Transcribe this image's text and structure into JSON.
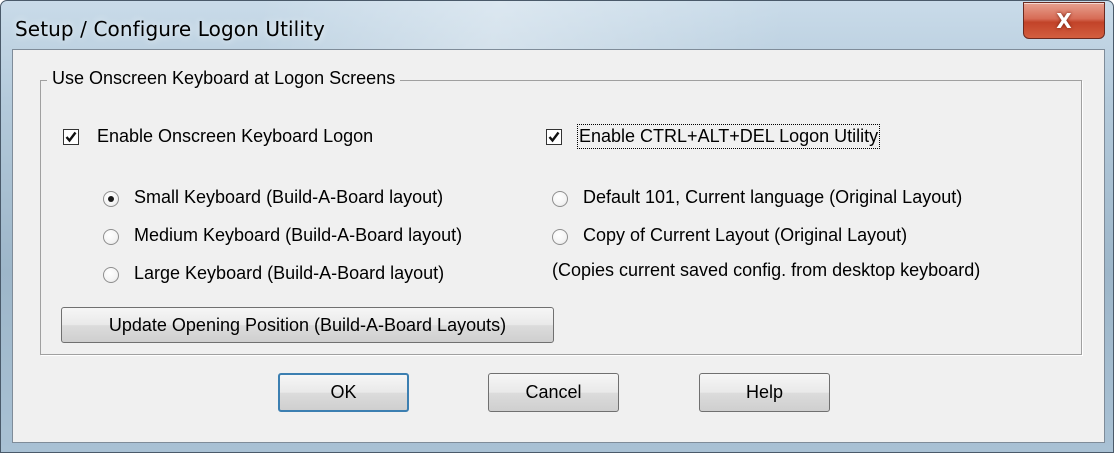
{
  "window": {
    "title": "Setup / Configure Logon Utility",
    "close_glyph": "X",
    "close_icon": "close-icon"
  },
  "group": {
    "legend": "Use Onscreen Keyboard at Logon Screens"
  },
  "options": {
    "enable_osk": {
      "label": "Enable Onscreen Keyboard Logon",
      "checked": true
    },
    "enable_cad": {
      "label": "Enable CTRL+ALT+DEL Logon Utility",
      "checked": true
    },
    "small": {
      "label": "Small Keyboard (Build-A-Board layout)",
      "selected": true
    },
    "medium": {
      "label": "Medium Keyboard (Build-A-Board layout)",
      "selected": false
    },
    "large": {
      "label": "Large Keyboard (Build-A-Board layout)",
      "selected": false
    },
    "default101": {
      "label": "Default 101, Current language (Original Layout)",
      "selected": false
    },
    "copy_layout": {
      "label": "Copy of Current Layout (Original Layout)",
      "selected": false
    },
    "copy_note": "(Copies current saved config. from desktop keyboard)"
  },
  "buttons": {
    "update": "Update Opening Position (Build-A-Board Layouts)",
    "ok": "OK",
    "cancel": "Cancel",
    "help": "Help"
  },
  "colors": {
    "close_button": "#c24329",
    "default_button_border": "#3c7fb1",
    "dialog_face": "#f0f0f0"
  }
}
